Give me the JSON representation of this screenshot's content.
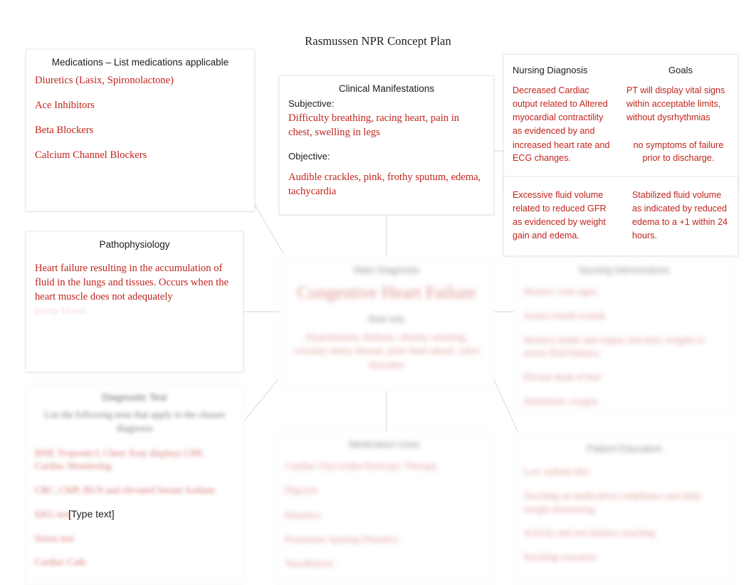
{
  "page": {
    "title": "Rasmussen NPR Concept Plan",
    "type_text_placeholder": "[Type text]",
    "accent_red": "#C0241C",
    "text_black": "#1c1c1c"
  },
  "medications_box": {
    "title": "Medications – List medications applicable",
    "items": [
      "Diuretics (Lasix, Spironolactone)",
      "Ace Inhibitors",
      "Beta Blockers",
      "Calcium Channel Blockers"
    ]
  },
  "pathophysiology_box": {
    "title": "Pathophysiology",
    "body": "Heart failure resulting in the accumulation of fluid in the lungs and tissues. Occurs when the heart muscle does not adequately",
    "faded_line": "pump blood."
  },
  "diagnostic_tests_box": {
    "title": "Diagnostic Test",
    "intro": "List the following tests that apply to the chosen diagnosis",
    "items": [
      "BNP, Troponin I, Chest Xray displays CHF, Cardiac Monitoring",
      "CBC, CMP, BUN and elevated Serum Sodium",
      "EKG test",
      "Stress test",
      "Cardiac Cath"
    ]
  },
  "clinical_manifestations_box": {
    "title": "Clinical Manifestations",
    "subjective_label": "Subjective:",
    "subjective_text": "Difficulty breathing, racing heart, pain in chest, swelling in legs",
    "objective_label": "Objective:",
    "objective_text": "Audible crackles, pink, frothy sputum, edema, tachycardia"
  },
  "center_box": {
    "main_label": "Main Diagnosis",
    "main_diagnosis": "Congestive Heart Failure",
    "sub_label": "Risk Info",
    "sub_body": "Hypertension, diabetes, obesity, smoking, coronary artery disease, prior heart attack, valve disorders"
  },
  "medications_bottom_box": {
    "title": "Medication Uses",
    "items": [
      "Cardiac Glycosides/Inotropic Therapy",
      "Digoxin",
      "Diuretics",
      "Potassium Sparing Diuretics",
      "Vasodilators"
    ]
  },
  "nursing_diagnosis_goals": {
    "headers": {
      "diagnosis": "Nursing Diagnosis",
      "goals": "Goals"
    },
    "rows": [
      {
        "diagnosis": "Decreased Cardiac output related to Altered myocardial contractility as evidenced by and",
        "diagnosis_2": "increased heart rate and ECG changes.",
        "goal": "PT will display vital signs within acceptable limits, without dysrhythmias",
        "goal_2": "no symptoms of failure prior to discharge."
      },
      {
        "diagnosis": "Excessive fluid volume related to reduced GFR as evidenced by weight gain and edema.",
        "goal": "Stabilized fluid volume as indicated by reduced edema to a +1 within 24 hours."
      }
    ]
  },
  "nursing_interventions_box": {
    "title": "Nursing Interventions",
    "items": [
      "Monitor vital signs",
      "Assess breath sounds",
      "Monitor intake and output and daily weights to assess fluid balance",
      "Elevate head of bed",
      "Administer oxygen"
    ]
  },
  "patient_education_box": {
    "title": "Patient Education",
    "items": [
      "Low sodium diet",
      "Teaching on medication compliance and daily weight monitoring",
      "Activity and rest balance teaching",
      "Smoking cessation"
    ]
  }
}
